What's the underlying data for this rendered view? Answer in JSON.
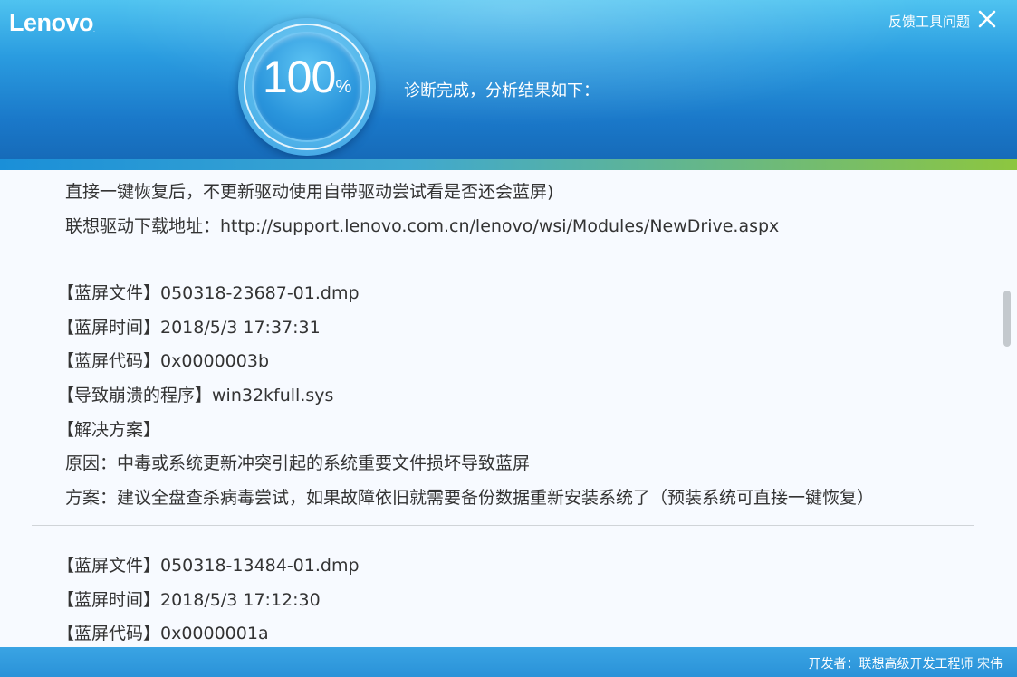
{
  "header": {
    "logo": "Lenovo",
    "logo_mark": ".",
    "feedback_label": "反馈工具问题",
    "progress_value": "100",
    "progress_unit": "%",
    "progress_fraction": 1.0,
    "status": "诊断完成，分析结果如下："
  },
  "results": {
    "intro_lines": [
      "直接一键恢复后，不更新驱动使用自带驱动尝试看是否还会蓝屏)",
      "联想驱动下载地址：http://support.lenovo.com.cn/lenovo/wsi/Modules/NewDrive.aspx"
    ],
    "records": [
      {
        "file": "【蓝屏文件】050318-23687-01.dmp",
        "time": "【蓝屏时间】2018/5/3 17:37:31",
        "code": "【蓝屏代码】0x0000003b",
        "program": "【导致崩溃的程序】win32kfull.sys",
        "solution_header": "【解决方案】",
        "cause": "原因：中毒或系统更新冲突引起的系统重要文件损坏导致蓝屏",
        "plan": "方案：建议全盘查杀病毒尝试，如果故障依旧就需要备份数据重新安装系统了（预装系统可直接一键恢复）"
      },
      {
        "file": "【蓝屏文件】050318-13484-01.dmp",
        "time": "【蓝屏时间】2018/5/3 17:12:30",
        "code": "【蓝屏代码】0x0000001a"
      }
    ]
  },
  "footer": {
    "developer": "开发者：联想高级开发工程师 宋伟"
  },
  "colors": {
    "header_top": "#4fc3f0",
    "header_bottom": "#166ab8",
    "accent_green": "#8dc63f",
    "body_bg": "#f7faff",
    "text": "#333333",
    "footer": "#2a92d8"
  }
}
